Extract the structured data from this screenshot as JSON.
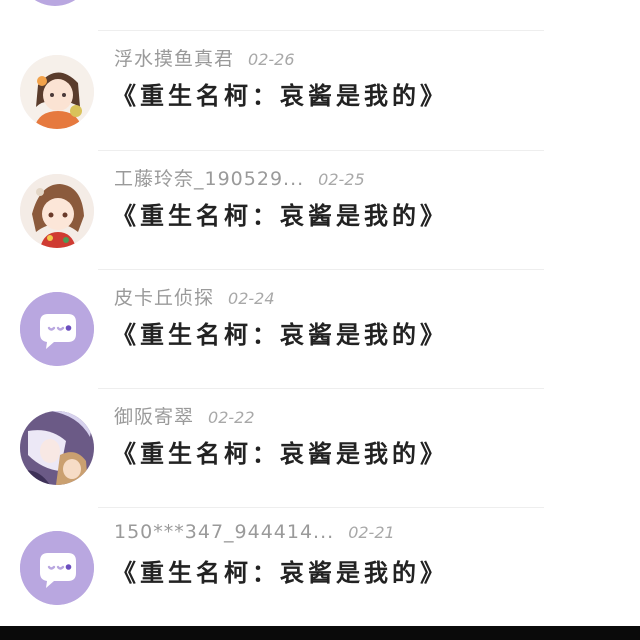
{
  "comments": [
    {
      "username": "浮水摸鱼真君",
      "date": "02-26",
      "text": "《重生名柯：哀酱是我的》",
      "avatar": "avatar-girl-orange"
    },
    {
      "username": "工藤玲奈_190529...",
      "date": "02-25",
      "text": "《重生名柯：哀酱是我的》",
      "avatar": "avatar-girl-red"
    },
    {
      "username": "皮卡丘侦探",
      "date": "02-24",
      "text": "《重生名柯：哀酱是我的》",
      "avatar": "default-chat-avatar"
    },
    {
      "username": "御阪寄翠",
      "date": "02-22",
      "text": "《重生名柯：哀酱是我的》",
      "avatar": "avatar-anime-dark"
    },
    {
      "username": "150***347_944414...",
      "date": "02-21",
      "text": "《重生名柯：哀酱是我的》",
      "avatar": "default-chat-avatar"
    }
  ],
  "colors": {
    "default_avatar": "#b9a7e0",
    "username": "#9a9a9a",
    "comment": "#222222",
    "divider": "#eeeeee"
  }
}
